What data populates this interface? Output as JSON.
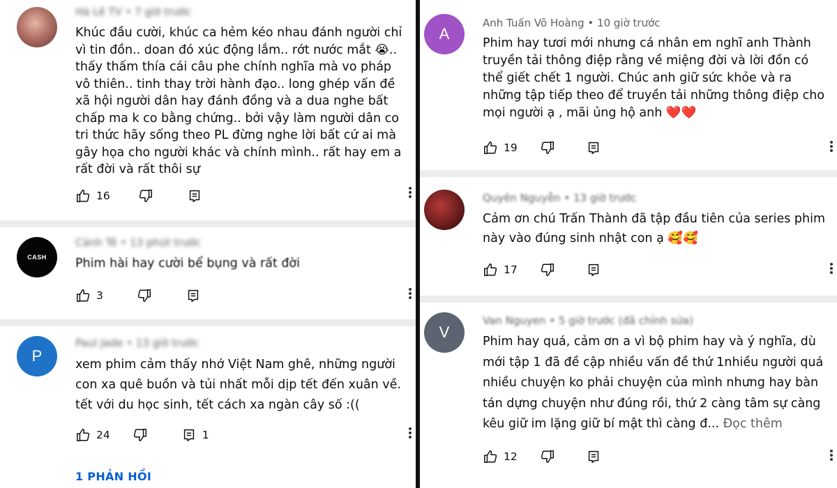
{
  "left": {
    "comments": [
      {
        "author": "Hà Lê TV",
        "time": "7 giờ trước",
        "text": "Khúc đầu cười, khúc ca hẻm kéo nhau đánh người chỉ vì tin đồn.. doan đó xúc động lắm.. rớt nước mắt 😭.. thấy thấm thía cái câu phe chính nghĩa mà vo pháp vô thiên.. tinh thay trời hành đạo.. long ghép vấn đề xã hội người dân hay đánh đồng và a dua nghe bất chấp ma k co bằng chứng.. bởi vậy làm người dân co tri thức hãy sống theo PL đừng nghe lời bất cứ ai mà gây họa cho người khác và chính mình.. rất hay em a rất đời và rất thôi sự",
        "likes": "16",
        "replies": ""
      },
      {
        "author": "Cảnh Tê",
        "time": "13 phút trước",
        "avatar_text": "CASH",
        "text": "Phim hài hay cười bể bụng và rất đời",
        "likes": "3",
        "replies": ""
      },
      {
        "author": "Paul Jade",
        "time": "13 giờ trước",
        "avatar_letter": "P",
        "text": "xem phim cảm thấy nhớ Việt Nam ghê, những người con xa quê buồn và tủi nhất mỗi dịp tết đến xuân về. tết với du học sinh, tết cách xa ngàn cây số :((",
        "likes": "24",
        "replies": "1"
      }
    ],
    "replies_link": "1 PHẢN HỒI"
  },
  "right": {
    "comments": [
      {
        "author": "Anh Tuấn Võ Hoàng",
        "time": "10 giờ trước",
        "avatar_letter": "A",
        "text": "Phim hay tươi mới nhưng cá nhân em nghĩ anh Thành truyền tải thông điệp rằng về miệng đời và lời đồn có thể giết chết 1 người. Chúc anh giữ sức khỏe và ra những tập tiếp theo để truyền tải những thông điệp cho mọi người ạ , mãi ủng hộ anh ❤️❤️",
        "likes": "19",
        "replies": ""
      },
      {
        "author": "Quyên Nguyễn",
        "time": "13 giờ trước",
        "text": "Cảm ơn chú Trấn Thành đã tập đầu tiên của series phim này vào đúng sinh nhật con ạ 🥰🥰",
        "likes": "17",
        "replies": ""
      },
      {
        "author": "Van Nguyen",
        "time": "5 giờ trước (đã chỉnh sửa)",
        "avatar_letter": "V",
        "text": "Phim hay quá, cảm ơn a vì bộ phim hay và ý nghĩa, dù mới tập 1 đã đề cập nhiều vấn đề thứ 1nhiều người quá nhiều chuyện ko phải chuyện của mình nhưng hay bàn tán dựng chuyện như đúng rồi, thứ 2 càng tâm sự càng kêu giữ im lặng giữ bí mật thì càng đ...",
        "more": "Đọc thêm",
        "likes": "12",
        "replies": ""
      }
    ]
  },
  "colors": {
    "text": "#0f0f0f",
    "meta": "#606060",
    "link": "#065fd4",
    "separator": "#ececec",
    "avatar_purple": "#a052c7",
    "avatar_blue": "#1e73c8",
    "avatar_slate": "#5b6470"
  },
  "icons": [
    "thumb-up-icon",
    "thumb-down-icon",
    "reply-icon",
    "more-vert-icon"
  ]
}
